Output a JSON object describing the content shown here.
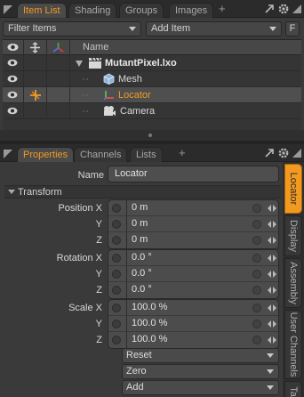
{
  "item_list_panel": {
    "tabs": [
      {
        "label": "Item List",
        "active": true
      },
      {
        "label": "Shading",
        "active": false
      },
      {
        "label": "Groups",
        "active": false
      },
      {
        "label": "Images",
        "active": false
      }
    ],
    "add_tab": "+",
    "filter_combo": "Filter Items",
    "add_item_combo": "Add Item",
    "filter_button": "F",
    "columns": {
      "name": "Name"
    },
    "items": [
      {
        "name": "MutantPixel.lxo",
        "icon": "scene-icon",
        "bold": true,
        "selected": false
      },
      {
        "name": "Mesh",
        "icon": "mesh-icon",
        "bold": false,
        "selected": false
      },
      {
        "name": "Locator",
        "icon": "locator-icon",
        "bold": false,
        "selected": true,
        "color": "#f29a20"
      },
      {
        "name": "Camera",
        "icon": "camera-icon",
        "bold": false,
        "selected": false
      }
    ]
  },
  "properties_panel": {
    "tabs": [
      {
        "label": "Properties",
        "active": true
      },
      {
        "label": "Channels",
        "active": false
      },
      {
        "label": "Lists",
        "active": false
      }
    ],
    "add_tab": "+",
    "name_label": "Name",
    "name_value": "Locator",
    "section_title": "Transform",
    "position": [
      {
        "label": "Position X",
        "value": "0 m"
      },
      {
        "label": "Y",
        "value": "0 m"
      },
      {
        "label": "Z",
        "value": "0 m"
      }
    ],
    "rotation": [
      {
        "label": "Rotation X",
        "value": "0.0 °"
      },
      {
        "label": "Y",
        "value": "0.0 °"
      },
      {
        "label": "Z",
        "value": "0.0 °"
      }
    ],
    "scale": [
      {
        "label": "Scale X",
        "value": "100.0 %"
      },
      {
        "label": "Y",
        "value": "100.0 %"
      },
      {
        "label": "Z",
        "value": "100.0 %"
      }
    ],
    "buttons": [
      "Reset",
      "Zero",
      "Add"
    ],
    "side_tabs": [
      {
        "label": "Locator",
        "active": true
      },
      {
        "label": "Display",
        "active": false
      },
      {
        "label": "Assembly",
        "active": false
      },
      {
        "label": "User Channels",
        "active": false
      },
      {
        "label": "Ta",
        "active": false
      }
    ]
  },
  "colors": {
    "accent": "#f29a20",
    "panel": "#3a3a3a",
    "field": "#4c4c4c"
  }
}
